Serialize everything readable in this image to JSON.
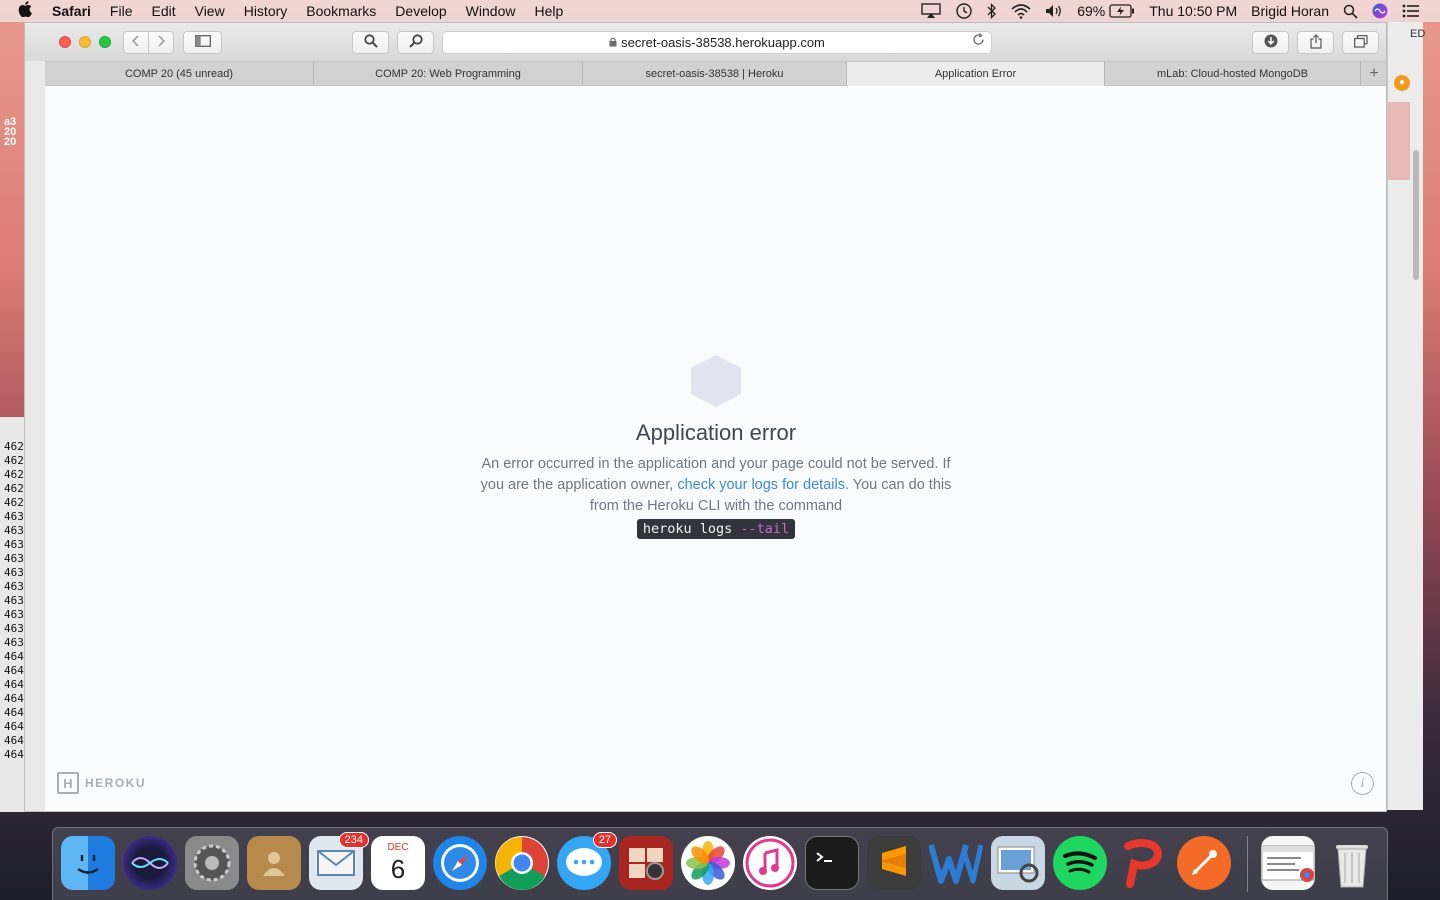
{
  "menubar": {
    "apple_icon": "apple-icon",
    "app_name": "Safari",
    "items": [
      "File",
      "Edit",
      "View",
      "History",
      "Bookmarks",
      "Develop",
      "Window",
      "Help"
    ],
    "battery": "69%",
    "clock": "Thu 10:50 PM",
    "user": "Brigid Horan"
  },
  "desktop": {
    "left_text": [
      "a3",
      "20",
      "20"
    ],
    "left_numbers": [
      "462",
      "462",
      "462",
      "462",
      "462",
      "463",
      "463",
      "463",
      "463",
      "463",
      "463",
      "463",
      "463",
      "463",
      "463",
      "464",
      "464",
      "464",
      "464",
      "464",
      "464",
      "464",
      "464"
    ],
    "right_window_text": "ED"
  },
  "browser": {
    "url": "secret-oasis-38538.herokuapp.com",
    "tabs": [
      {
        "label": "COMP 20 (45 unread)",
        "active": false
      },
      {
        "label": "COMP 20: Web Programming",
        "active": false
      },
      {
        "label": "secret-oasis-38538 | Heroku",
        "active": false
      },
      {
        "label": "Application Error",
        "active": true
      },
      {
        "label": "mLab: Cloud-hosted MongoDB",
        "active": false
      }
    ],
    "new_tab_label": "+"
  },
  "page": {
    "title": "Application error",
    "message_1": "An error occurred in the application and your page could not be served. If you are the application owner, ",
    "link_text": "check your logs for details",
    "message_2": ". You can do this from the Heroku CLI with the command",
    "command": "heroku logs ",
    "command_flag": "--tail",
    "logo_text": "HEROKU",
    "logo_letter": "H",
    "info_label": "i"
  },
  "dock": {
    "mail_badge": "234",
    "messages_badge": "27",
    "calendar_month": "DEC",
    "calendar_day": "6"
  },
  "colors": {
    "link": "#3b8bd6",
    "hexagon": "#dfe4ef",
    "command_bg": "#32333d",
    "command_flag": "#c66bd0"
  }
}
